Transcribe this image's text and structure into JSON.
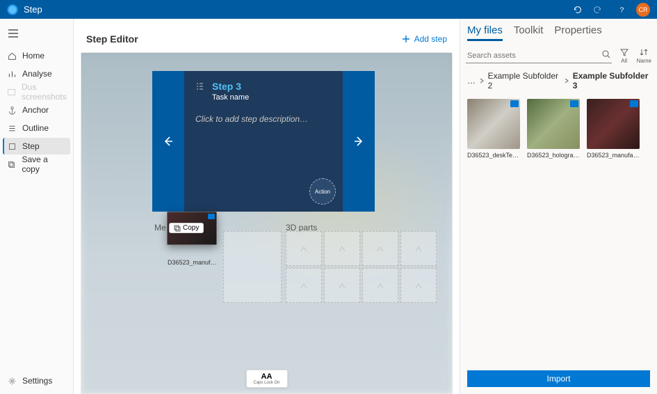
{
  "titlebar": {
    "title": "Step",
    "avatar_initials": "CR"
  },
  "sidebar": {
    "items": [
      {
        "label": "Home"
      },
      {
        "label": "Analyse"
      },
      {
        "label": "Dus screenshots"
      },
      {
        "label": "Anchor"
      },
      {
        "label": "Outline"
      },
      {
        "label": "Step"
      },
      {
        "label": "Save a copy"
      }
    ],
    "settings_label": "Settings"
  },
  "editor": {
    "title": "Step Editor",
    "add_step": "Add step",
    "step": {
      "number": "Step 3",
      "task": "Task name",
      "desc_placeholder": "Click to add step description…",
      "action_label": "Action"
    },
    "media_label": "Me",
    "parts_label": "3D parts",
    "drag_copy": "Copy",
    "drag_name": "D36523_manufacturi...",
    "caps_big": "AA",
    "caps_small": "Caps Lock On"
  },
  "panel": {
    "tabs": [
      "My files",
      "Toolkit",
      "Properties"
    ],
    "search_placeholder": "Search assets",
    "filter_all": "All",
    "sort_name": "Name",
    "breadcrumb": [
      "…",
      "Example Subfolder 2",
      "Example Subfolder 3"
    ],
    "assets": [
      {
        "name": "D36523_deskTeams_..."
      },
      {
        "name": "D36523_hologram_w..."
      },
      {
        "name": "D36523_manufacturi..."
      }
    ],
    "import_label": "Import"
  }
}
